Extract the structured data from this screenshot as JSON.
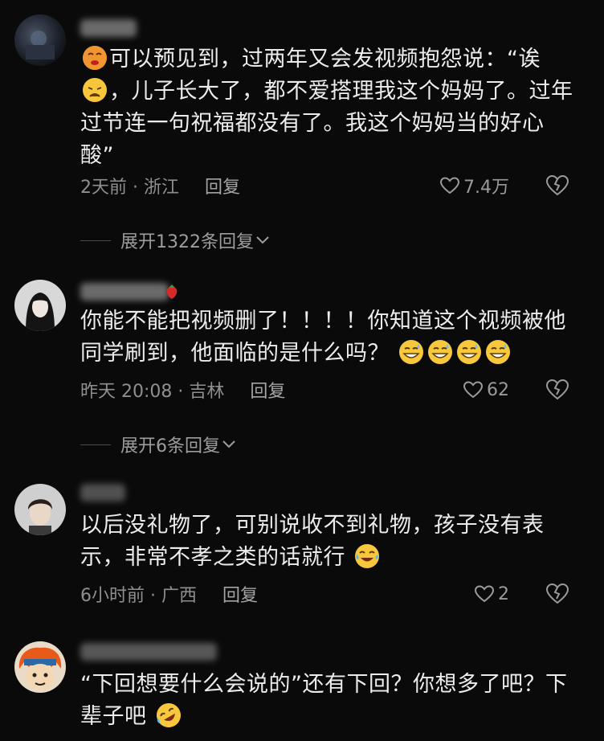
{
  "comments": [
    {
      "text_1": "可以预见到，过两年又会发视频抱怨说：“诶",
      "text_2": "，儿子长大了，都不爱搭理我这个妈妈了。过年",
      "text_3": "过节连一句祝福都没有了。我这个妈妈当的好心",
      "text_4": "酸”",
      "time_location": "2天前 · 浙江",
      "reply_label": "回复",
      "likes": "7.4万",
      "expand_label": "展开1322条回复"
    },
    {
      "username": "草莓",
      "text_1": "你能不能把视频删了！！！！你知道这个视频被他",
      "text_2": "同学刷到，他面临的是什么吗？",
      "time_location": "昨天 20:08 · 吉林",
      "reply_label": "回复",
      "likes": "62",
      "expand_label": "展开6条回复"
    },
    {
      "text_1": "以后没礼物了，可别说收不到礼物，孩子没有表",
      "text_2": "示，非常不孝之类的话就行",
      "time_location": "6小时前 · 广西",
      "reply_label": "回复",
      "likes": "2"
    },
    {
      "text_1": "“下回想要什么会说的”还有下回？你想多了吧？下",
      "text_2": "辈子吧"
    }
  ],
  "colors": {
    "background": "#0a0a0a",
    "text": "#ececec",
    "meta": "#8f8f8f"
  },
  "icons": [
    "heart-icon",
    "dislike-heart-icon",
    "chevron-down-icon"
  ]
}
